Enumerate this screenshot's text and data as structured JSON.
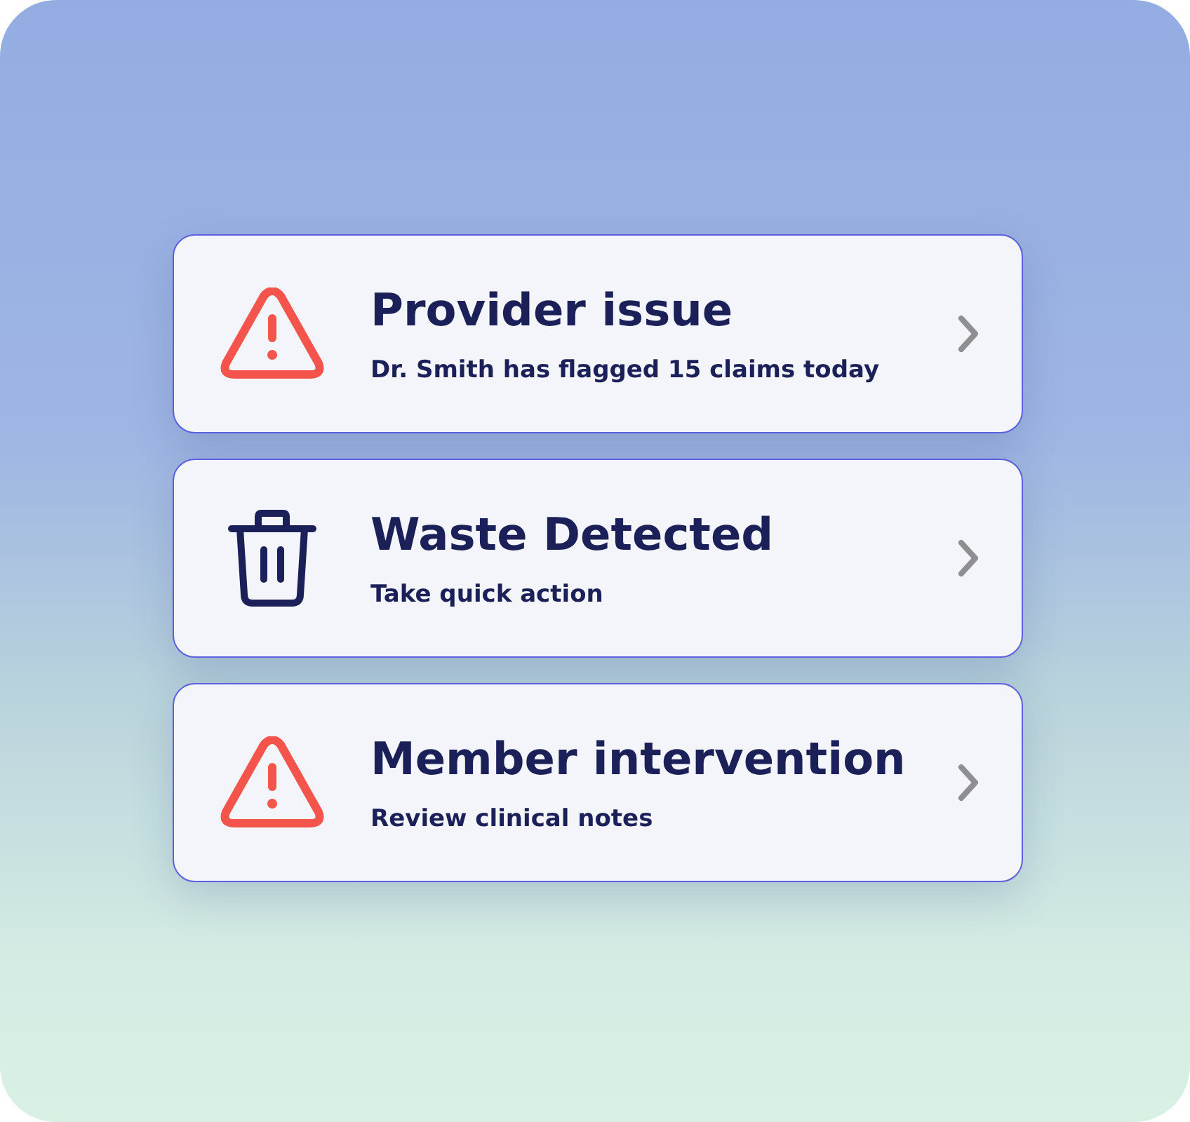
{
  "alerts": [
    {
      "kind": "warning",
      "title": "Provider issue",
      "subtitle": "Dr. Smith has flagged 15 claims today"
    },
    {
      "kind": "trash",
      "title": "Waste Detected",
      "subtitle": "Take quick action"
    },
    {
      "kind": "warning",
      "title": "Member intervention",
      "subtitle": "Review clinical notes"
    }
  ]
}
